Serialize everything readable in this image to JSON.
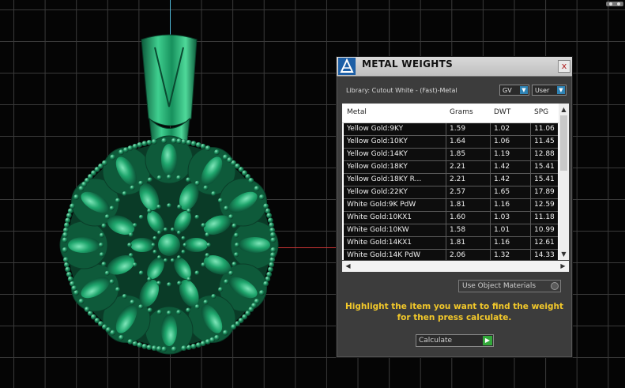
{
  "colors": {
    "background": "#050505",
    "grid": "#3a3a3a",
    "model_green": "#1b8f5e",
    "hint_yellow": "#f2c82a",
    "dropdown_blue": "#2e83b5",
    "calc_green": "#32a83a"
  },
  "viewport": {
    "model": "jewelry-pendant-3d-model",
    "corner_icon": "toolbar-logo-icon"
  },
  "panel": {
    "title": "METAL WEIGHTS",
    "close_label": "x",
    "library_label": "Library: Cutout White - (Fast)-Metal",
    "dropdown_gv": "GV",
    "dropdown_user": "User",
    "table": {
      "headers": [
        "Metal",
        "Grams",
        "DWT",
        "SPG"
      ],
      "rows": [
        [
          "Yellow Gold:9KY",
          "1.59",
          "1.02",
          "11.06"
        ],
        [
          "Yellow Gold:10KY",
          "1.64",
          "1.06",
          "11.45"
        ],
        [
          "Yellow Gold:14KY",
          "1.85",
          "1.19",
          "12.88"
        ],
        [
          "Yellow Gold:18KY",
          "2.21",
          "1.42",
          "15.41"
        ],
        [
          "Yellow Gold:18KY R...",
          "2.21",
          "1.42",
          "15.41"
        ],
        [
          "Yellow Gold:22KY",
          "2.57",
          "1.65",
          "17.89"
        ],
        [
          "White Gold:9K PdW",
          "1.81",
          "1.16",
          "12.59"
        ],
        [
          "White Gold:10KX1",
          "1.60",
          "1.03",
          "11.18"
        ],
        [
          "White Gold:10KW",
          "1.58",
          "1.01",
          "10.99"
        ],
        [
          "White Gold:14KX1",
          "1.81",
          "1.16",
          "12.61"
        ],
        [
          "White Gold:14K PdW",
          "2.06",
          "1.32",
          "14.33"
        ]
      ]
    },
    "use_object_materials": "Use Object Materials",
    "hint_line1": "Highlight the item you want to find the weight",
    "hint_line2": "for then press calculate.",
    "calculate_label": "Calculate"
  }
}
